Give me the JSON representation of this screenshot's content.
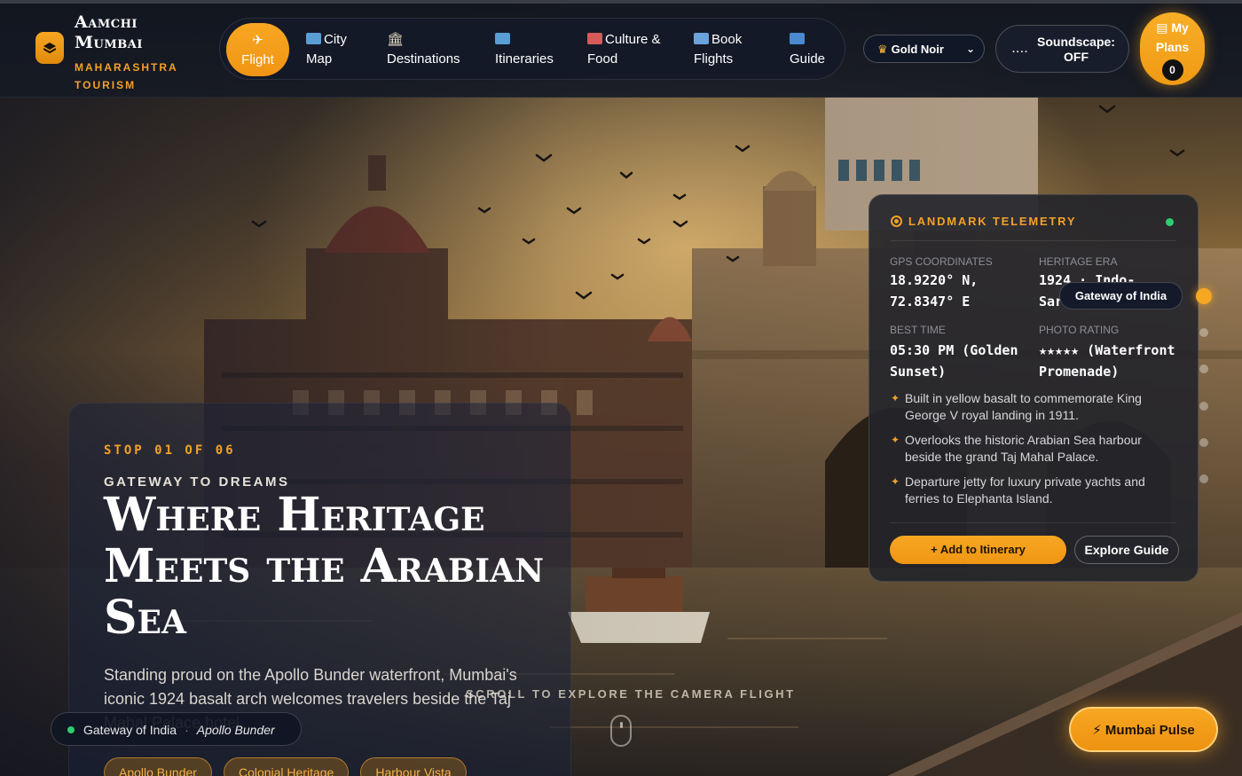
{
  "brand": {
    "title": "Aamchi Mumbai",
    "subtitle": "MAHARASHTRA TOURISM"
  },
  "nav": {
    "items": [
      {
        "label": "Flight",
        "icon": "airplane-icon",
        "active": true
      },
      {
        "label": "City Map",
        "icon": "map-icon"
      },
      {
        "label": "Destinations",
        "icon": "landmark-icon"
      },
      {
        "label": "Itineraries",
        "icon": "map-icon"
      },
      {
        "label": "Culture & Food",
        "icon": "culture-icon"
      },
      {
        "label": "Book Flights",
        "icon": "plane-ticket-icon"
      },
      {
        "label": "Guide",
        "icon": "info-icon"
      }
    ]
  },
  "theme": {
    "selected": "Gold Noir",
    "icon": "crown-icon"
  },
  "soundscape": {
    "bars": "····",
    "label": "Soundscape: OFF"
  },
  "plans": {
    "label": "My Plans",
    "count": "0",
    "icon": "clipboard-icon"
  },
  "hero": {
    "stop": "STOP 01 OF 06",
    "kicker": "GATEWAY TO DREAMS",
    "headline": "Where Heritage Meets the Arabian Sea",
    "lede": "Standing proud on the Apollo Bunder waterfront, Mumbai's iconic 1924 basalt arch welcomes travelers beside the Taj Mahal Palace hotel.",
    "chips": [
      "Apollo Bunder",
      "Colonial Heritage",
      "Harbour Vista"
    ]
  },
  "location": {
    "name": "Gateway of India",
    "sub": "Apollo Bunder"
  },
  "scroll_hint": "SCROLL TO EXPLORE THE CAMERA FLIGHT",
  "telemetry": {
    "title": "LANDMARK TELEMETRY",
    "gps_label": "GPS COORDINATES",
    "gps_value": "18.9220° N,\n72.8347° E",
    "era_label": "HERITAGE ERA",
    "era_value": "1924 · Indo-\nSaracenic",
    "time_label": "BEST TIME",
    "time_value": "05:30 PM (Golden\nSunset)",
    "rating_label": "PHOTO RATING",
    "rating_value": "★★★★★ (Waterfront\nPromenade)",
    "facts": [
      "Built in yellow basalt to commemorate King George V royal landing in 1911.",
      "Overlooks the historic Arabian Sea harbour beside the grand Taj Mahal Palace.",
      "Departure jetty for luxury private yachts and ferries to Elephanta Island."
    ],
    "add_label": "+ Add to Itinerary",
    "guide_label": "Explore Guide"
  },
  "tooltip": "Gateway of India",
  "pulse": {
    "label": "⚡ Mumbai Pulse"
  },
  "colors": {
    "accent": "#f5a623",
    "panel": "#22242a",
    "live": "#2ecc71"
  }
}
